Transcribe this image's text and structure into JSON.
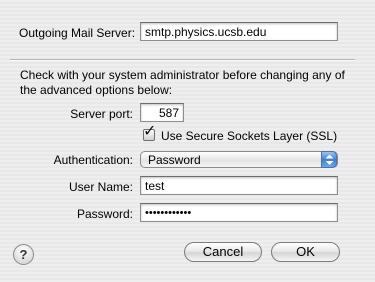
{
  "server": {
    "label": "Outgoing Mail Server:",
    "value": "smtp.physics.ucsb.edu"
  },
  "note": "Check with your system administrator before changing any of the advanced options below:",
  "port": {
    "label": "Server port:",
    "value": "587"
  },
  "ssl": {
    "label": "Use Secure Sockets Layer (SSL)",
    "checked": true
  },
  "auth": {
    "label": "Authentication:",
    "selected": "Password"
  },
  "username": {
    "label": "User Name:",
    "value": "test"
  },
  "password": {
    "label": "Password:",
    "value": "••••••••••••"
  },
  "buttons": {
    "help": "?",
    "cancel": "Cancel",
    "ok": "OK"
  }
}
